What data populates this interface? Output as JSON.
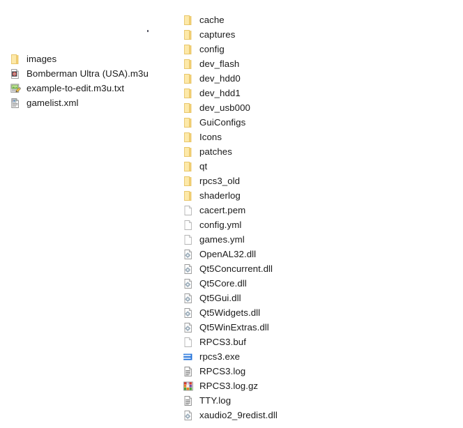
{
  "window": {
    "background_color": "#ffffff",
    "text_color": "#1a1a1a"
  },
  "colors": {
    "folder_fill": "#fde9a9",
    "folder_tab": "#f5cf73",
    "folder_edge": "#e8c66a",
    "document_fill": "#ffffff",
    "document_edge": "#b4b4b4",
    "exe_blue": "#1e6fd9",
    "archive_red": "#d8392b",
    "archive_green": "#4aa53a",
    "archive_purple": "#7b4aa0",
    "archive_orange": "#e8832a"
  },
  "left_column": {
    "items": [
      {
        "name": "images",
        "icon": "folder-icon",
        "type": "folder"
      },
      {
        "name": "Bomberman Ultra (USA).m3u",
        "icon": "media-playlist-icon",
        "type": "file"
      },
      {
        "name": "example-to-edit.m3u.txt",
        "icon": "text-editor-icon",
        "type": "file"
      },
      {
        "name": "gamelist.xml",
        "icon": "xml-document-icon",
        "type": "file"
      }
    ]
  },
  "right_column": {
    "items": [
      {
        "name": "cache",
        "icon": "folder-icon",
        "type": "folder"
      },
      {
        "name": "captures",
        "icon": "folder-icon",
        "type": "folder"
      },
      {
        "name": "config",
        "icon": "folder-icon",
        "type": "folder"
      },
      {
        "name": "dev_flash",
        "icon": "folder-icon",
        "type": "folder"
      },
      {
        "name": "dev_hdd0",
        "icon": "folder-icon",
        "type": "folder"
      },
      {
        "name": "dev_hdd1",
        "icon": "folder-icon",
        "type": "folder"
      },
      {
        "name": "dev_usb000",
        "icon": "folder-icon",
        "type": "folder"
      },
      {
        "name": "GuiConfigs",
        "icon": "folder-icon",
        "type": "folder"
      },
      {
        "name": "Icons",
        "icon": "folder-icon",
        "type": "folder"
      },
      {
        "name": "patches",
        "icon": "folder-icon",
        "type": "folder"
      },
      {
        "name": "qt",
        "icon": "folder-icon",
        "type": "folder"
      },
      {
        "name": "rpcs3_old",
        "icon": "folder-icon",
        "type": "folder"
      },
      {
        "name": "shaderlog",
        "icon": "folder-icon",
        "type": "folder"
      },
      {
        "name": "cacert.pem",
        "icon": "blank-document-icon",
        "type": "file"
      },
      {
        "name": "config.yml",
        "icon": "blank-document-icon",
        "type": "file"
      },
      {
        "name": "games.yml",
        "icon": "blank-document-icon",
        "type": "file"
      },
      {
        "name": "OpenAL32.dll",
        "icon": "dll-gear-document-icon",
        "type": "file"
      },
      {
        "name": "Qt5Concurrent.dll",
        "icon": "dll-gear-document-icon",
        "type": "file"
      },
      {
        "name": "Qt5Core.dll",
        "icon": "dll-gear-document-icon",
        "type": "file"
      },
      {
        "name": "Qt5Gui.dll",
        "icon": "dll-gear-document-icon",
        "type": "file"
      },
      {
        "name": "Qt5Widgets.dll",
        "icon": "dll-gear-document-icon",
        "type": "file"
      },
      {
        "name": "Qt5WinExtras.dll",
        "icon": "dll-gear-document-icon",
        "type": "file"
      },
      {
        "name": "RPCS3.buf",
        "icon": "blank-document-icon",
        "type": "file"
      },
      {
        "name": "rpcs3.exe",
        "icon": "executable-icon",
        "type": "file"
      },
      {
        "name": "RPCS3.log",
        "icon": "log-document-icon",
        "type": "file"
      },
      {
        "name": "RPCS3.log.gz",
        "icon": "archive-icon",
        "type": "file"
      },
      {
        "name": "TTY.log",
        "icon": "log-document-icon",
        "type": "file"
      },
      {
        "name": "xaudio2_9redist.dll",
        "icon": "dll-gear-document-icon",
        "type": "file"
      }
    ]
  }
}
